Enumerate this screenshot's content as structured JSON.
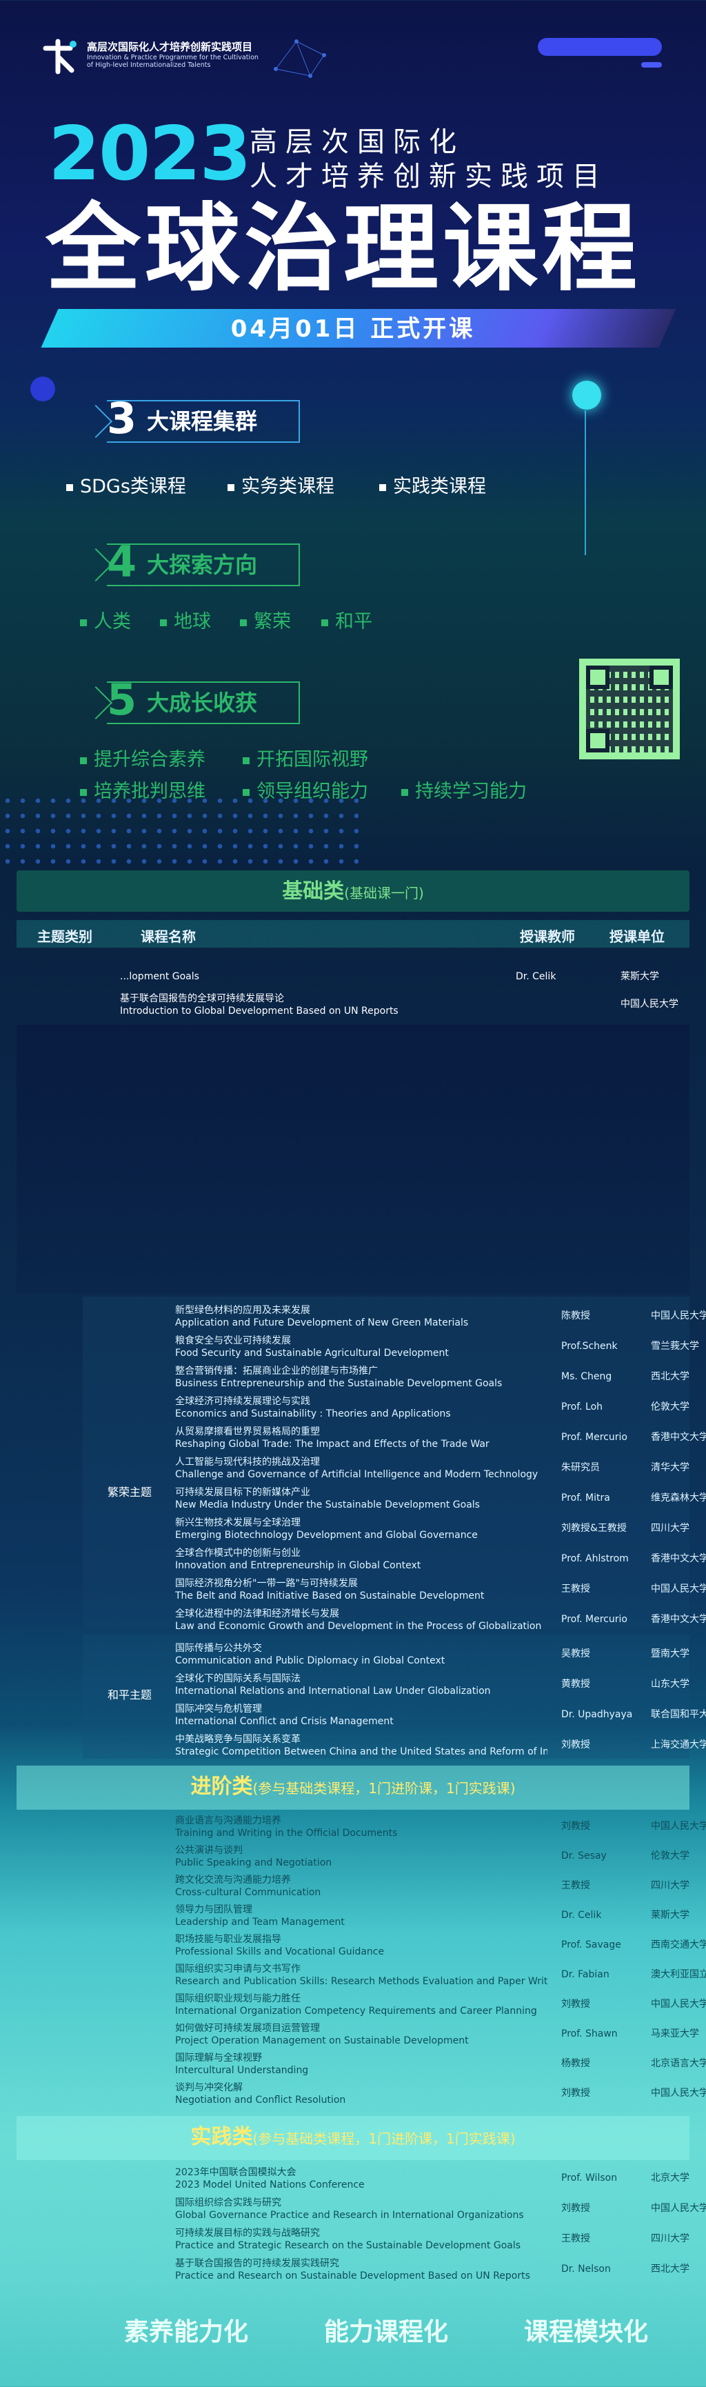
{
  "header": {
    "logo_cn": "高层次国际化人才培养创新实践项目",
    "logo_en": "Innovation & Practice Programme for the Cultivation of High-level Internationalized Talents",
    "year": "2023",
    "subtitle_line1": "高层次国际化",
    "subtitle_line2": "人才培养创新实践项目",
    "title": "全球治理课程",
    "date": "04月01日 正式开课"
  },
  "clusters": {
    "num": "3",
    "label": "大课程集群",
    "items": [
      "SDGs类课程",
      "实务类课程",
      "实践类课程"
    ]
  },
  "directions": {
    "num": "4",
    "label": "大探索方向",
    "items": [
      "人类",
      "地球",
      "繁荣",
      "和平"
    ]
  },
  "growth": {
    "num": "5",
    "label": "大成长收获",
    "items": [
      "提升综合素养",
      "开拓国际视野",
      "培养批判思维",
      "领导组织能力",
      "持续学习能力"
    ]
  },
  "basic": {
    "title": "基础类",
    "title_note": "(基础课一门)",
    "headers": [
      "主题类别",
      "课程名称",
      "授课教师",
      "授课单位"
    ],
    "rows": [
      {
        "cn": "",
        "en": "...lopment Goals",
        "teacher": "Dr. Celik",
        "school": "莱斯大学"
      },
      {
        "cn": "基于联合国报告的全球可持续发展导论",
        "en": "Introduction to Global Development Based on UN Reports",
        "teacher": "",
        "school": "中国人民大学"
      },
      {
        "cn": "",
        "en": "",
        "teacher": "",
        "school": ""
      }
    ]
  },
  "prosperity": {
    "group": "繁荣主题",
    "rows": [
      {
        "cn": "新型绿色材料的应用及未来发展",
        "en": "Application and Future Development of New Green Materials",
        "teacher": "陈教授",
        "school": "中国人民大学"
      },
      {
        "cn": "粮食安全与农业可持续发展",
        "en": "Food Security and Sustainable Agricultural Development",
        "teacher": "Prof.Schenk",
        "school": "雪兰莪大学"
      },
      {
        "cn": "整合营销传播：拓展商业企业的创建与市场推广",
        "en": "Business Entrepreneurship and the Sustainable Development Goals",
        "teacher": "Ms. Cheng",
        "school": "西北大学"
      },
      {
        "cn": "全球经济可持续发展理论与实践",
        "en": "Economics and Sustainability : Theories and Applications",
        "teacher": "Prof. Loh",
        "school": "伦敦大学"
      },
      {
        "cn": "从贸易摩擦看世界贸易格局的重塑",
        "en": "Reshaping Global Trade: The Impact and Effects of the Trade War",
        "teacher": "Prof. Mercurio",
        "school": "香港中文大学"
      },
      {
        "cn": "人工智能与现代科技的挑战及治理",
        "en": "Challenge and Governance of Artificial Intelligence and Modern Technology",
        "teacher": "朱研究员",
        "school": "清华大学"
      },
      {
        "cn": "可持续发展目标下的新媒体产业",
        "en": "New Media Industry Under the Sustainable Development Goals",
        "teacher": "Prof. Mitra",
        "school": "维克森林大学"
      },
      {
        "cn": "新兴生物技术发展与全球治理",
        "en": "Emerging Biotechnology Development and Global Governance",
        "teacher": "刘教授&王教授",
        "school": "四川大学"
      },
      {
        "cn": "全球合作模式中的创新与创业",
        "en": "Innovation and Entrepreneurship in Global Context",
        "teacher": "Prof. Ahlstrom",
        "school": "香港中文大学"
      },
      {
        "cn": "国际经济视角分析\"一带一路\"与可持续发展",
        "en": "The Belt and Road Initiative Based on Sustainable Development",
        "teacher": "王教授",
        "school": "中国人民大学"
      },
      {
        "cn": "全球化进程中的法律和经济增长与发展",
        "en": "Law and Economic Growth and Development in the Process of Globalization",
        "teacher": "Prof. Mercurio",
        "school": "香港中文大学"
      }
    ]
  },
  "peace": {
    "group": "和平主题",
    "rows": [
      {
        "cn": "国际传播与公共外交",
        "en": "Communication and Public Diplomacy in Global Context",
        "teacher": "吴教授",
        "school": "暨南大学"
      },
      {
        "cn": "全球化下的国际关系与国际法",
        "en": "International Relations and International Law Under Globalization",
        "teacher": "黄教授",
        "school": "山东大学"
      },
      {
        "cn": "国际冲突与危机管理",
        "en": "International Conflict and Crisis Management",
        "teacher": "Dr. Upadhyaya",
        "school": "联合国和平大学"
      },
      {
        "cn": "中美战略竞争与国际关系变革",
        "en": "Strategic Competition Between China and the United States and Reform of International Relations",
        "teacher": "刘教授",
        "school": "上海交通大学"
      }
    ]
  },
  "advanced": {
    "title": "进阶类",
    "title_note": "(参与基础类课程，1门进阶课，1门实践课)",
    "rows": [
      {
        "cn": "商业语言与沟通能力培养",
        "en": "Training and Writing in the Official Documents",
        "teacher": "刘教授",
        "school": "中国人民大学"
      },
      {
        "cn": "公共演讲与谈判",
        "en": "Public Speaking and Negotiation",
        "teacher": "Dr. Sesay",
        "school": "伦敦大学"
      },
      {
        "cn": "跨文化交流与沟通能力培养",
        "en": "Cross-cultural Communication",
        "teacher": "王教授",
        "school": "四川大学"
      },
      {
        "cn": "领导力与团队管理",
        "en": "Leadership and Team Management",
        "teacher": "Dr. Celik",
        "school": "莱斯大学"
      },
      {
        "cn": "职场技能与职业发展指导",
        "en": "Professional Skills and Vocational Guidance",
        "teacher": "Prof. Savage",
        "school": "西南交通大学"
      },
      {
        "cn": "国际组织实习申请与文书写作",
        "en": "Research and Publication Skills: Research Methods Evaluation and Paper Writing",
        "teacher": "Dr. Fabian",
        "school": "澳大利亚国立大学"
      },
      {
        "cn": "国际组织职业规划与能力胜任",
        "en": "International Organization Competency Requirements and Career Planning",
        "teacher": "刘教授",
        "school": "中国人民大学"
      },
      {
        "cn": "如何做好可持续发展项目运营管理",
        "en": "Project Operation Management on Sustainable Development",
        "teacher": "Prof. Shawn",
        "school": "马来亚大学"
      },
      {
        "cn": "国际理解与全球视野",
        "en": "Intercultural Understanding",
        "teacher": "杨教授",
        "school": "北京语言大学"
      },
      {
        "cn": "谈判与冲突化解",
        "en": "Negotiation and Conflict Resolution",
        "teacher": "刘教授",
        "school": "中国人民大学"
      }
    ]
  },
  "practice": {
    "title": "实践类",
    "title_note": "(参与基础类课程，1门进阶课，1门实践课)",
    "rows": [
      {
        "cn": "2023年中国联合国模拟大会",
        "en": "2023 Model United Nations Conference",
        "teacher": "Prof. Wilson",
        "school": "北京大学"
      },
      {
        "cn": "国际组织综合实践与研究",
        "en": "Global Governance Practice and Research in International Organizations",
        "teacher": "刘教授",
        "school": "中国人民大学"
      },
      {
        "cn": "可持续发展目标的实践与战略研究",
        "en": "Practice and Strategic Research on the Sustainable Development Goals",
        "teacher": "王教授",
        "school": "四川大学"
      },
      {
        "cn": "基于联合国报告的可持续发展实践研究",
        "en": "Practice and Research on Sustainable Development Based on UN Reports",
        "teacher": "Dr. Nelson",
        "school": "西北大学"
      }
    ]
  },
  "slogans": [
    "素养能力化",
    "能力课程化",
    "课程模块化"
  ],
  "colors": {
    "accent_cyan": "#28d8f2",
    "accent_blue": "#3c4af0",
    "green_section": "#7be08a"
  }
}
